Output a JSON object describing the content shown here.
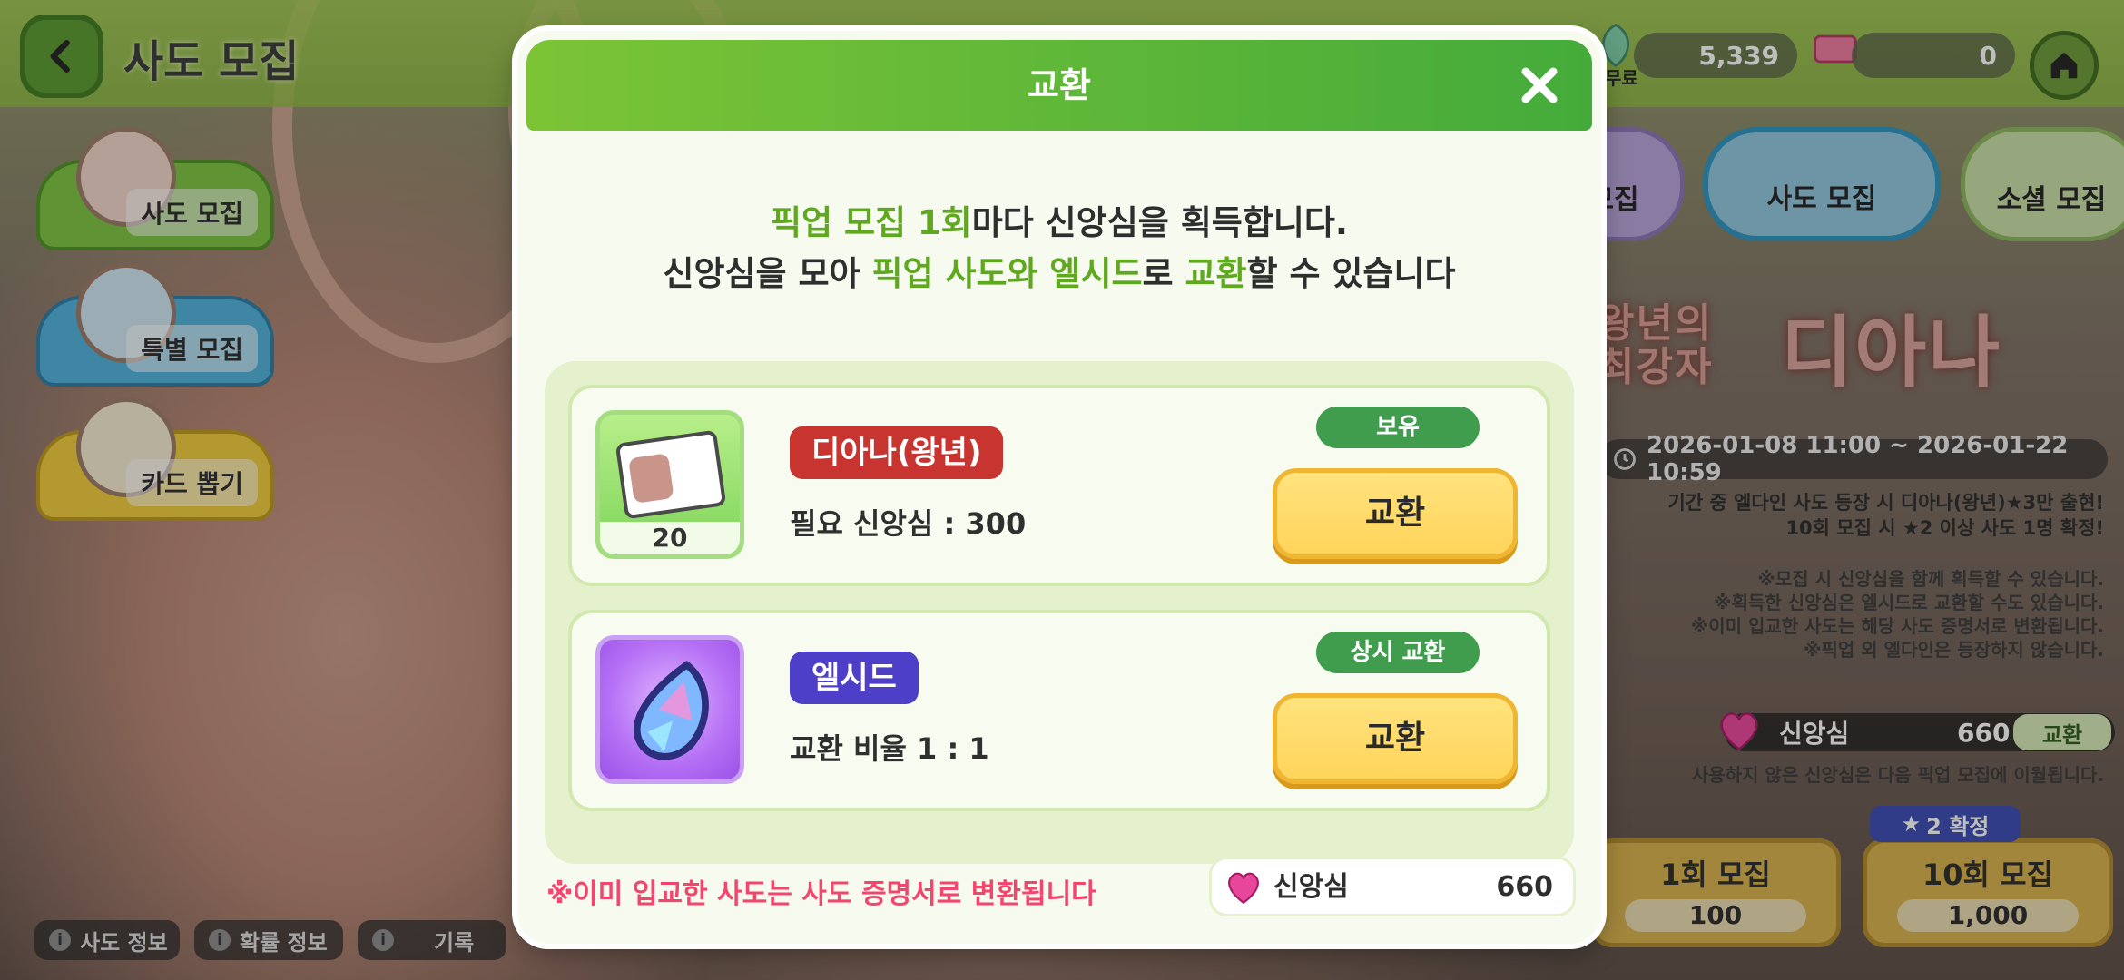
{
  "header": {
    "page_title": "사도 모집",
    "currency_free_label": "무료",
    "currency_free_value": "5,339",
    "currency_ticket_value": "0"
  },
  "sidebar": {
    "items": [
      {
        "label": "사도 모집"
      },
      {
        "label": "특별 모집"
      },
      {
        "label": "카드 뽑기"
      }
    ]
  },
  "tabs": [
    {
      "label": "모집"
    },
    {
      "label": "사도 모집"
    },
    {
      "label": "소셜 모집"
    }
  ],
  "banner": {
    "title": "디아나",
    "subtitle": "왕년의 최강자",
    "period": "2026-01-08 11:00 ~ 2026-01-22 10:59",
    "lines": [
      "기간 중 엘다인 사도 등장 시 디아나(왕년)★3만 출현!",
      "10회 모집 시 ★2 이상 사도 1명 확정!"
    ],
    "notes": [
      "※모집 시 신앙심을 함께 획득할 수 있습니다.",
      "※획득한 신앙심은 엘시드로 교환할 수도 있습니다.",
      "※이미 입교한 사도는 해당 사도 증명서로 변환됩니다.",
      "※픽업 외 엘다인은 등장하지 않습니다."
    ],
    "faith_label": "신앙심",
    "faith_value": "660",
    "faith_exchange": "교환",
    "faith_note": "사용하지 않은 신앙심은 다음 픽업 모집에 이월됩니다.",
    "confirm_badge": "2 확정",
    "pull_1_label": "1회 모집",
    "pull_1_cost": "100",
    "pull_10_label": "10회 모집",
    "pull_10_cost": "1,000"
  },
  "bottom": {
    "info": "사도 정보",
    "rate": "확률 정보",
    "log": "기록"
  },
  "modal": {
    "title": "교환",
    "desc_line1_hl": "픽업 모집 1회",
    "desc_line1_rest": "마다 신앙심을 획득합니다.",
    "desc_line2_a": "신앙심을 모아 ",
    "desc_line2_hl1": "픽업 사도와 엘시드",
    "desc_line2_b": "로 ",
    "desc_line2_hl2": "교환",
    "desc_line2_c": "할 수 있습니다",
    "items": [
      {
        "name": "디아나(왕년)",
        "detail": "필요 신앙심 : 300",
        "count": "20",
        "badge": "보유",
        "button": "교환"
      },
      {
        "name": "엘시드",
        "detail": "교환 비율 1 : 1",
        "badge": "상시 교환",
        "button": "교환"
      }
    ],
    "notice": "※이미 입교한 사도는 사도 증명서로 변환됩니다",
    "balance_label": "신앙심",
    "balance_value": "660"
  },
  "colors": {
    "header_green": "#44ab3a",
    "highlight_green": "#5fa81f",
    "name_red": "#c8342f",
    "name_blue": "#4e3fc8",
    "badge_green": "#3f9d4d",
    "button_yellow": "#ffd45a",
    "notice_pink": "#f2466e"
  }
}
